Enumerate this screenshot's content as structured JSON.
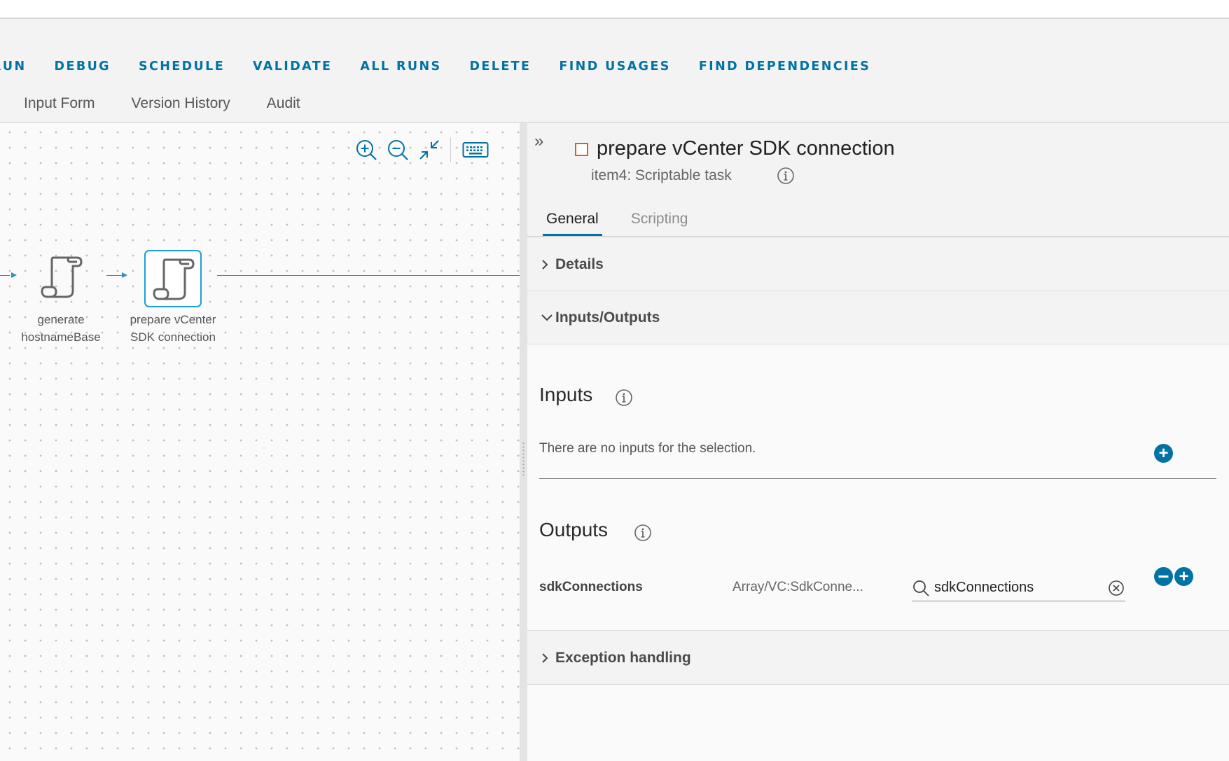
{
  "toolbar": {
    "actions": [
      "RUN",
      "DEBUG",
      "SCHEDULE",
      "VALIDATE",
      "ALL RUNS",
      "DELETE",
      "FIND USAGES",
      "FIND DEPENDENCIES"
    ],
    "tabs": [
      "Input Form",
      "Version History",
      "Audit"
    ]
  },
  "canvas": {
    "tools": [
      "zoom-in-icon",
      "zoom-out-icon",
      "fit-to-screen-icon",
      "keyboard-icon"
    ],
    "nodes": [
      {
        "label": "generate hostnameBase",
        "label_line1": "generate",
        "label_line2": "hostnameBase",
        "selected": false
      },
      {
        "label": "prepare vCenter SDK connection",
        "label_line1": "prepare vCenter",
        "label_line2": "SDK connection",
        "selected": true
      }
    ]
  },
  "panel": {
    "title": "prepare vCenter SDK connection",
    "subtitle": "item4: Scriptable task",
    "tabs": [
      {
        "label": "General",
        "active": true
      },
      {
        "label": "Scripting",
        "active": false
      }
    ],
    "sections": {
      "details": {
        "title": "Details",
        "expanded": false
      },
      "io": {
        "title": "Inputs/Outputs",
        "expanded": true
      },
      "exception": {
        "title": "Exception handling",
        "expanded": false
      }
    },
    "inputs": {
      "title": "Inputs",
      "empty_text": "There are no inputs for the selection."
    },
    "outputs": {
      "title": "Outputs",
      "rows": [
        {
          "name": "sdkConnections",
          "type": "Array/VC:SdkConne...",
          "binding": "sdkConnections"
        }
      ]
    }
  },
  "colors": {
    "accent": "#0072a3",
    "selected_border": "#1a9fd8",
    "task_marker": "#e05a2b"
  }
}
